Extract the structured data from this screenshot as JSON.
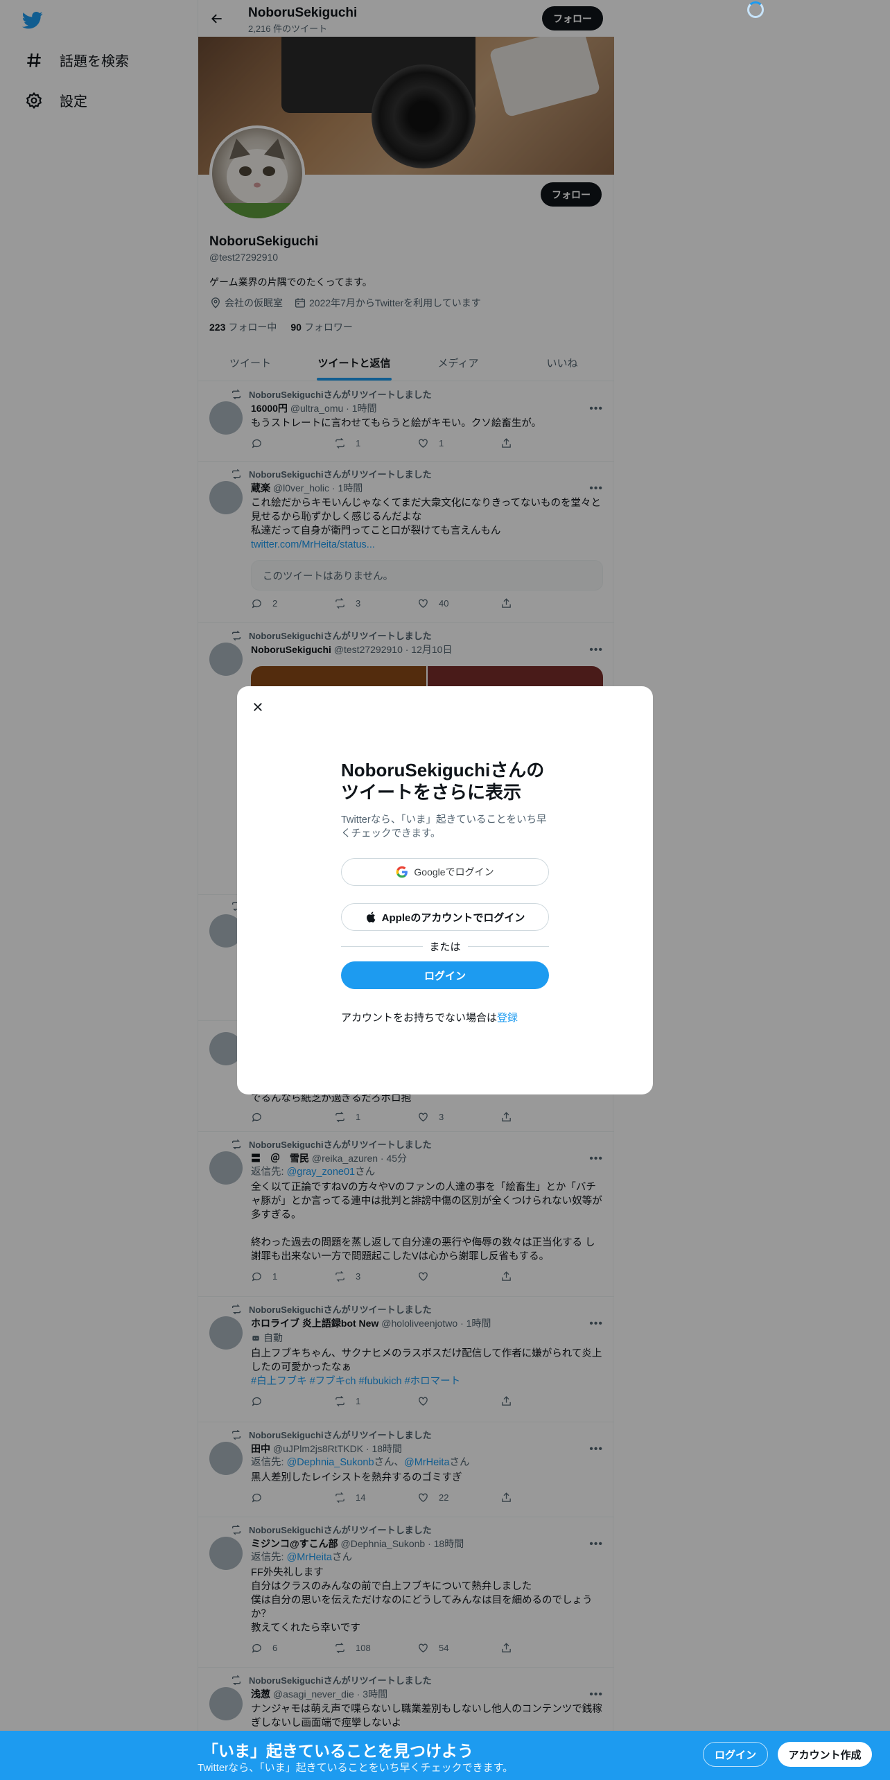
{
  "nav": {
    "explore_label": "話題を検索",
    "settings_label": "設定"
  },
  "header": {
    "name": "NoboruSekiguchi",
    "tweet_count": "2,216 件のツイート",
    "follow_label": "フォロー"
  },
  "profile": {
    "follow_label": "フォロー",
    "name": "NoboruSekiguchi",
    "handle": "@test27292910",
    "bio": "ゲーム業界の片隅でのたくってます。",
    "location": "会社の仮眠室",
    "joined": "2022年7月からTwitterを利用しています",
    "following_count": "223",
    "following_label": "フォロー中",
    "followers_count": "90",
    "followers_label": "フォロワー"
  },
  "tabs": [
    {
      "label": "ツイート"
    },
    {
      "label": "ツイートと返信"
    },
    {
      "label": "メディア"
    },
    {
      "label": "いいね"
    }
  ],
  "retweet_label": "NoboruSekiguchiさんがリツイートしました",
  "tweets": [
    {
      "name": "16000円",
      "meta": "@ultra_omu · 1時間",
      "text": "もうストレートに言わせてもらうと絵がキモい。クソ絵畜生が。",
      "replies": "",
      "retweets": "1",
      "likes": "1"
    },
    {
      "name": "蔵楽",
      "meta": "@l0ver_holic · 1時間",
      "text": "これ絵だからキモいんじゃなくてまだ大衆文化になりきってないものを堂々と見せるから恥ずかしく感じるんだよな\n私達だって自身が衛門ってこと口が裂けても言えんもん",
      "link": "twitter.com/MrHeita/status...",
      "quote": "このツイートはありません。",
      "replies": "2",
      "retweets": "3",
      "likes": "40"
    },
    {
      "name": "NoboruSekiguchi",
      "meta": "@test27292910 · 12月10日"
    },
    {
      "partial_text": "でるんなら紙芝が過ぎるだろボロ抱",
      "replies": "",
      "retweets": "1",
      "likes": "3"
    },
    {
      "name": "〓　＠　雪民",
      "meta": "@reika_azuren · 45分",
      "reply_prefix": "返信先: ",
      "reply_to": "@gray_zone01",
      "reply_suffix": "さん",
      "text": "全く以て正論ですねVの方々やVのファンの人達の事を「絵畜生」とか「バチャ豚が」とか言ってる連中は批判と誹謗中傷の区別が全くつけられない奴等が多すぎる。\n\n終わった過去の問題を蒸し返して自分達の悪行や侮辱の数々は正当化する し謝罪も出来ない一方で問題起こしたVは心から謝罪し反省もする。",
      "replies": "1",
      "retweets": "3",
      "likes": ""
    },
    {
      "name": "ホロライブ 炎上語録bot New",
      "meta": "@hololiveenjotwo · 1時間",
      "auto_label": "自動",
      "text": "白上フブキちゃん、サクナヒメのラスボスだけ配信して作者に嫌がられて炎上したの可愛かったなぁ",
      "hashtags": "#白上フブキ #フブキch #fubukich #ホロマート",
      "replies": "",
      "retweets": "1",
      "likes": ""
    },
    {
      "name": "田中",
      "meta": "@uJPlm2js8RtTKDK · 18時間",
      "reply_prefix": "返信先: ",
      "reply_to": "@Dephnia_Sukonb",
      "reply_mid": "さん、",
      "reply_to2": "@MrHeita",
      "reply_suffix": "さん",
      "text": "黒人差別したレイシストを熱弁するのゴミすぎ",
      "replies": "",
      "retweets": "14",
      "likes": "22"
    },
    {
      "name": "ミジンコ@すこん部",
      "meta": "@Dephnia_Sukonb · 18時間",
      "reply_prefix": "返信先: ",
      "reply_to": "@MrHeita",
      "reply_suffix": "さん",
      "text": "FF外失礼します\n自分はクラスのみんなの前で白上フブキについて熱弁しました\n僕は自分の思いを伝えただけなのにどうしてみんなは目を細めるのでしょうか？\n教えてくれたら幸いです",
      "replies": "6",
      "retweets": "108",
      "likes": "54"
    },
    {
      "name": "浅葱",
      "meta": "@asagi_never_die · 3時間",
      "text": "ナンジャモは萌え声で喋らないし職業差別もしないし他人のコンテンツで銭稼ぎしないし画面端で痙攣しないよ"
    }
  ],
  "modal": {
    "title": "NoboruSekiguchiさんの\nツイートをさらに表示",
    "subtitle": "Twitterなら、「いま」起きていることをいち早くチェックできます。",
    "google_label": "Googleでログイン",
    "apple_label": "Appleのアカウントでログイン",
    "or_label": "または",
    "login_label": "ログイン",
    "signup_prompt": "アカウントをお持ちでない場合は",
    "signup_link": "登録"
  },
  "bottom_bar": {
    "title": "「いま」起きていることを見つけよう",
    "subtitle": "Twitterなら、「いま」起きていることをいち早くチェックできます。",
    "login_label": "ログイン",
    "signup_label": "アカウント作成"
  },
  "colors": {
    "accent": "#1d9bf0",
    "text": "#0f1419",
    "secondary": "#536471"
  }
}
